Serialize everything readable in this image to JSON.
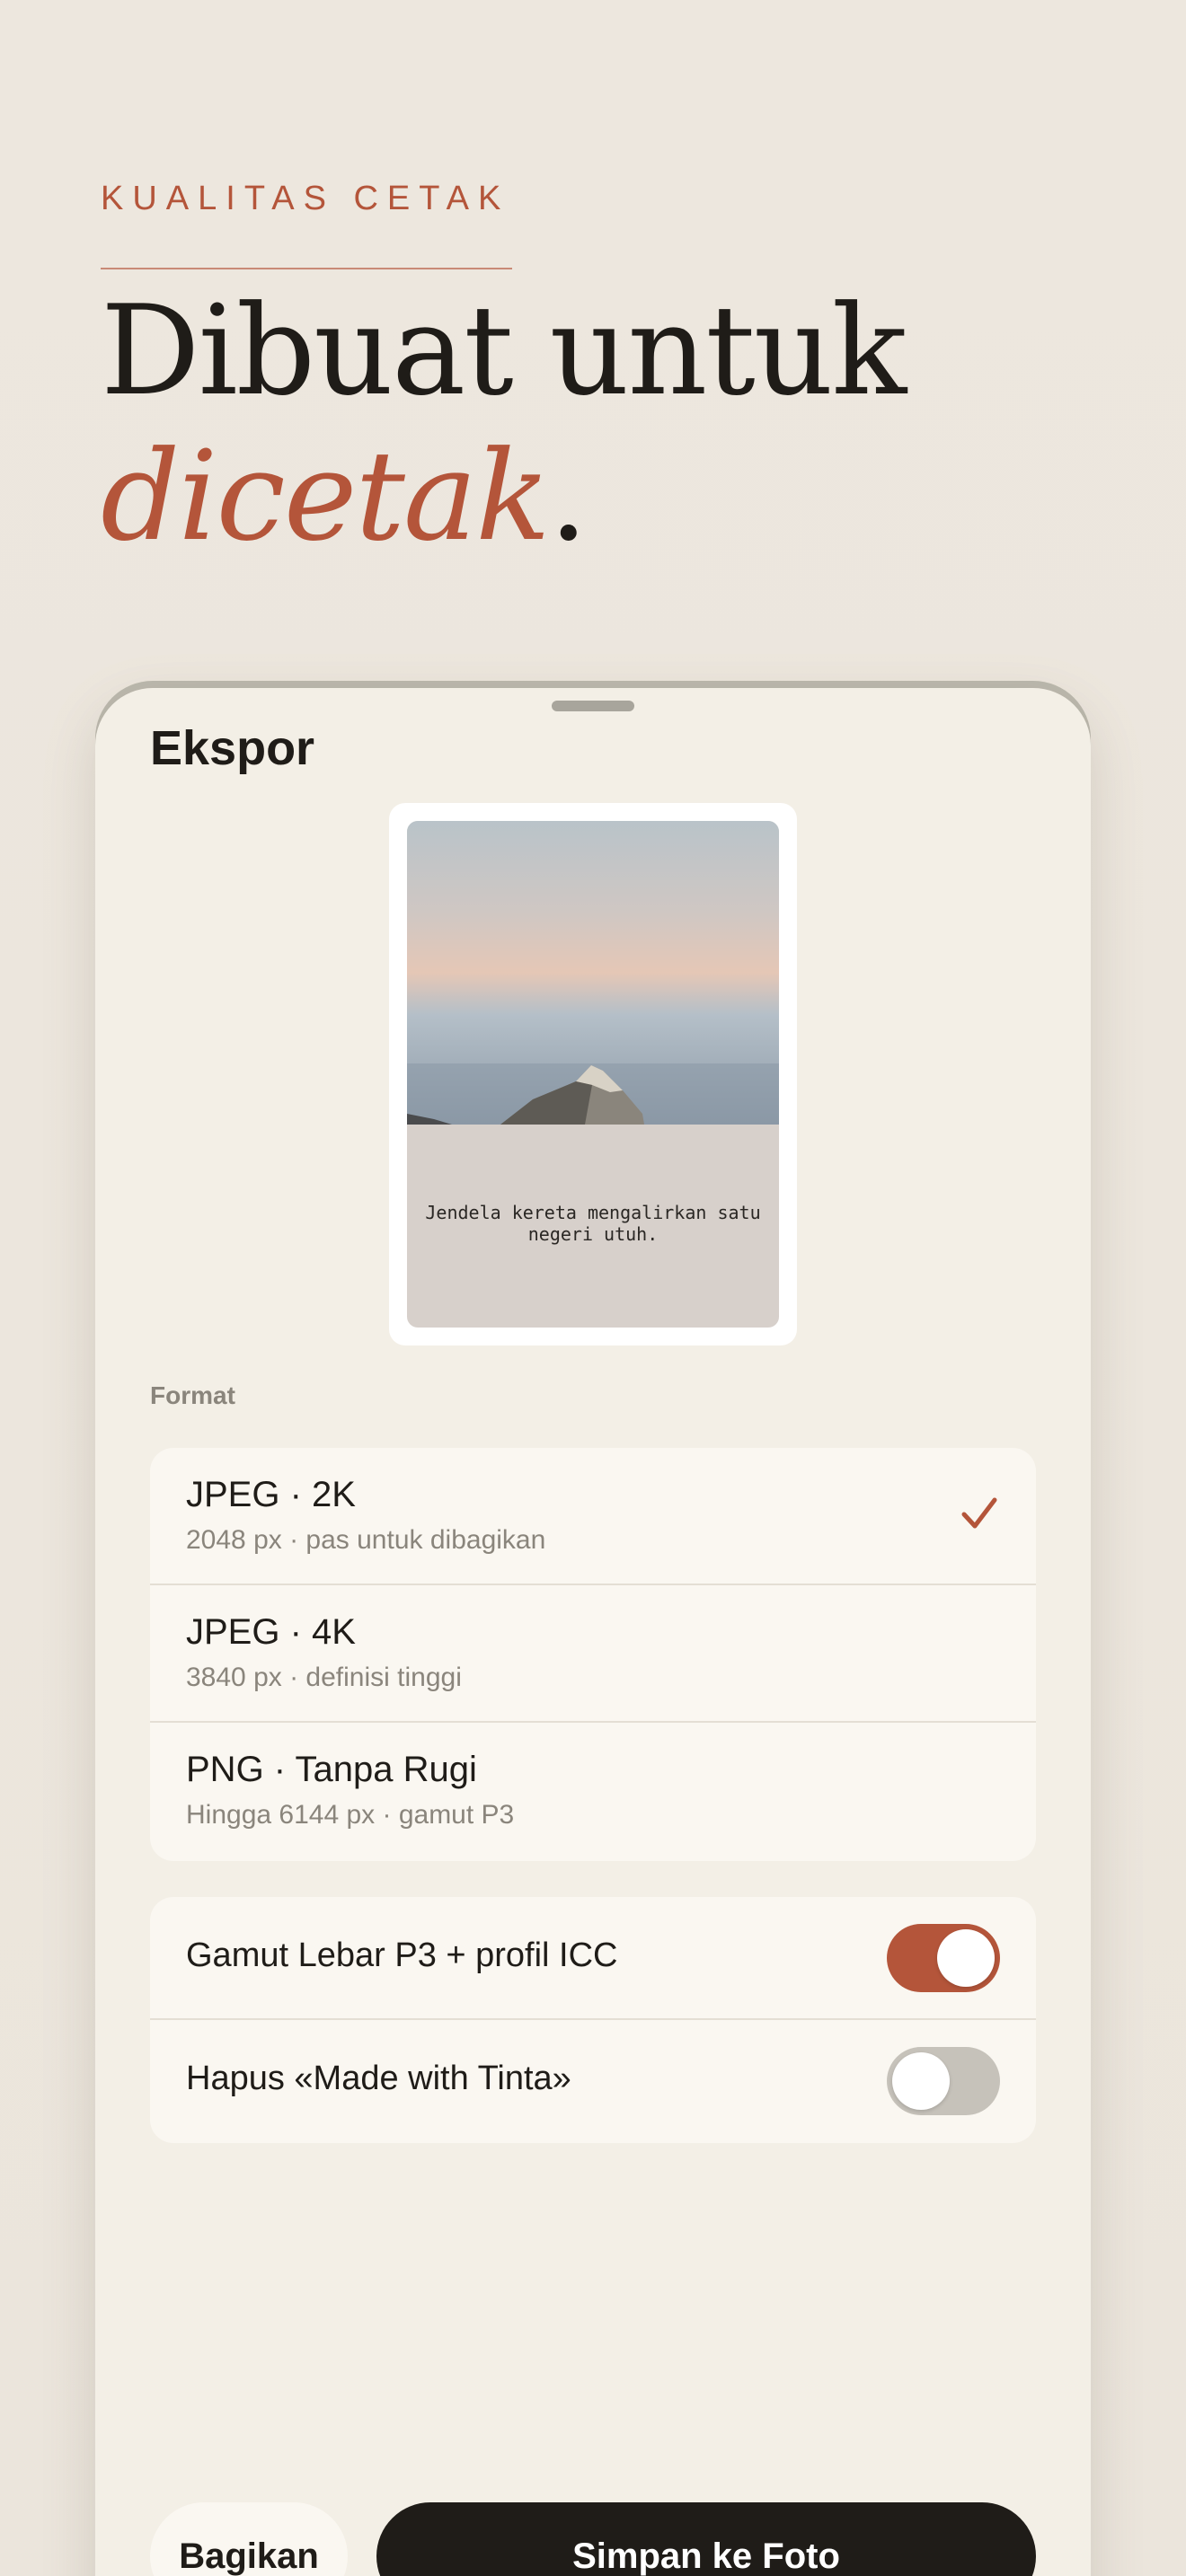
{
  "hero": {
    "eyebrow": "KUALITAS CETAK",
    "headline_line1": "Dibuat untuk",
    "headline_accent": "dicetak",
    "headline_period": "."
  },
  "sheet": {
    "title": "Ekspor",
    "preview_caption": "Jendela kereta mengalirkan satu negeri utuh.",
    "format_label": "Format",
    "formats": [
      {
        "title": "JPEG · 2K",
        "subtitle": "2048 px · pas untuk dibagikan",
        "selected": true
      },
      {
        "title": "JPEG · 4K",
        "subtitle": "3840 px · definisi tinggi",
        "selected": false
      },
      {
        "title": "PNG · Tanpa Rugi",
        "subtitle": "Hingga 6144 px · gamut P3",
        "selected": false
      }
    ],
    "toggles": [
      {
        "label": "Gamut Lebar P3 + profil ICC",
        "on": true
      },
      {
        "label": "Hapus «Made with Tinta»",
        "on": false
      }
    ],
    "share_label": "Bagikan",
    "save_label": "Simpan ke Foto"
  },
  "colors": {
    "accent": "#b4553a",
    "ink": "#1f1c18",
    "background": "#ede7de"
  },
  "icons": {
    "selected": "checkmark-icon"
  }
}
